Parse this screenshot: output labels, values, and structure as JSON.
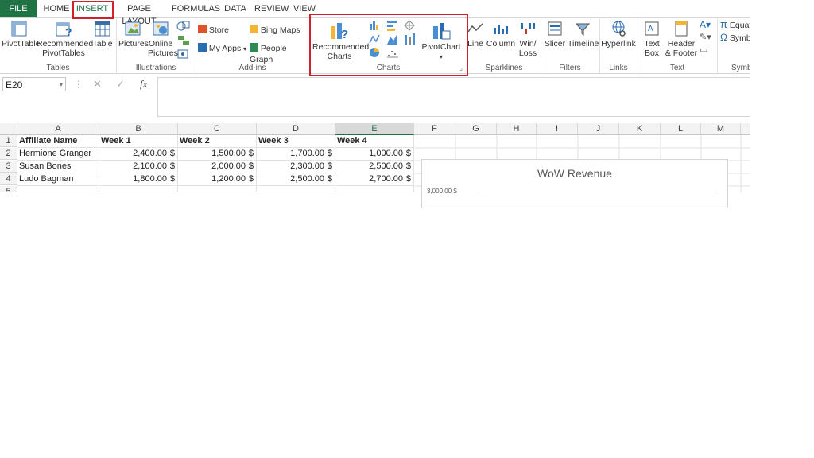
{
  "tabs": {
    "file": "FILE",
    "home": "HOME",
    "insert": "INSERT",
    "page_layout": "PAGE LAYOUT",
    "formulas": "FORMULAS",
    "data": "DATA",
    "review": "REVIEW",
    "view": "VIEW"
  },
  "ribbon": {
    "tables": {
      "label": "Tables",
      "pivottable": "PivotTable",
      "recommended_line1": "Recommended",
      "recommended_line2": "PivotTables",
      "table": "Table"
    },
    "illustrations": {
      "label": "Illustrations",
      "pictures": "Pictures",
      "online_line1": "Online",
      "online_line2": "Pictures"
    },
    "addins": {
      "label": "Add-ins",
      "store": "Store",
      "my_apps": "My Apps",
      "bing_maps": "Bing Maps",
      "people_graph": "People Graph"
    },
    "charts": {
      "label": "Charts",
      "recommended_line1": "Recommended",
      "recommended_line2": "Charts",
      "pivotchart": "PivotChart"
    },
    "sparklines": {
      "label": "Sparklines",
      "line": "Line",
      "column": "Column",
      "winloss_line1": "Win/",
      "winloss_line2": "Loss"
    },
    "filters": {
      "label": "Filters",
      "slicer": "Slicer",
      "timeline": "Timeline"
    },
    "links": {
      "label": "Links",
      "hyperlink": "Hyperlink"
    },
    "text": {
      "label": "Text",
      "textbox_line1": "Text",
      "textbox_line2": "Box",
      "header_line1": "Header",
      "header_line2": "& Footer"
    },
    "symbols": {
      "label": "Symb",
      "equation": "Equat",
      "symbol": "Symb"
    }
  },
  "formula_bar": {
    "name_box": "E20",
    "fx": "fx"
  },
  "sheet": {
    "columns": [
      "A",
      "B",
      "C",
      "D",
      "E",
      "F",
      "G",
      "H",
      "I",
      "J",
      "K",
      "L",
      "M"
    ],
    "rows": [
      "1",
      "2",
      "3",
      "4",
      "5"
    ],
    "header_row": [
      "Affiliate Name",
      "Week 1",
      "Week 2",
      "Week 3",
      "Week 4"
    ],
    "data": [
      [
        "Hermione Granger",
        "2,400.00",
        "1,500.00",
        "1,700.00",
        "1,000.00"
      ],
      [
        "Susan Bones",
        "2,100.00",
        "2,000.00",
        "2,300.00",
        "2,500.00"
      ],
      [
        "Ludo Bagman",
        "1,800.00",
        "1,200.00",
        "2,500.00",
        "2,700.00"
      ]
    ],
    "currency": "$"
  },
  "chart": {
    "title": "WoW Revenue",
    "top_tick": "3,000.00",
    "currency": "$"
  },
  "colors": {
    "file_tab": "#217346",
    "highlight": "#d0202a",
    "accent_green": "#217346"
  }
}
